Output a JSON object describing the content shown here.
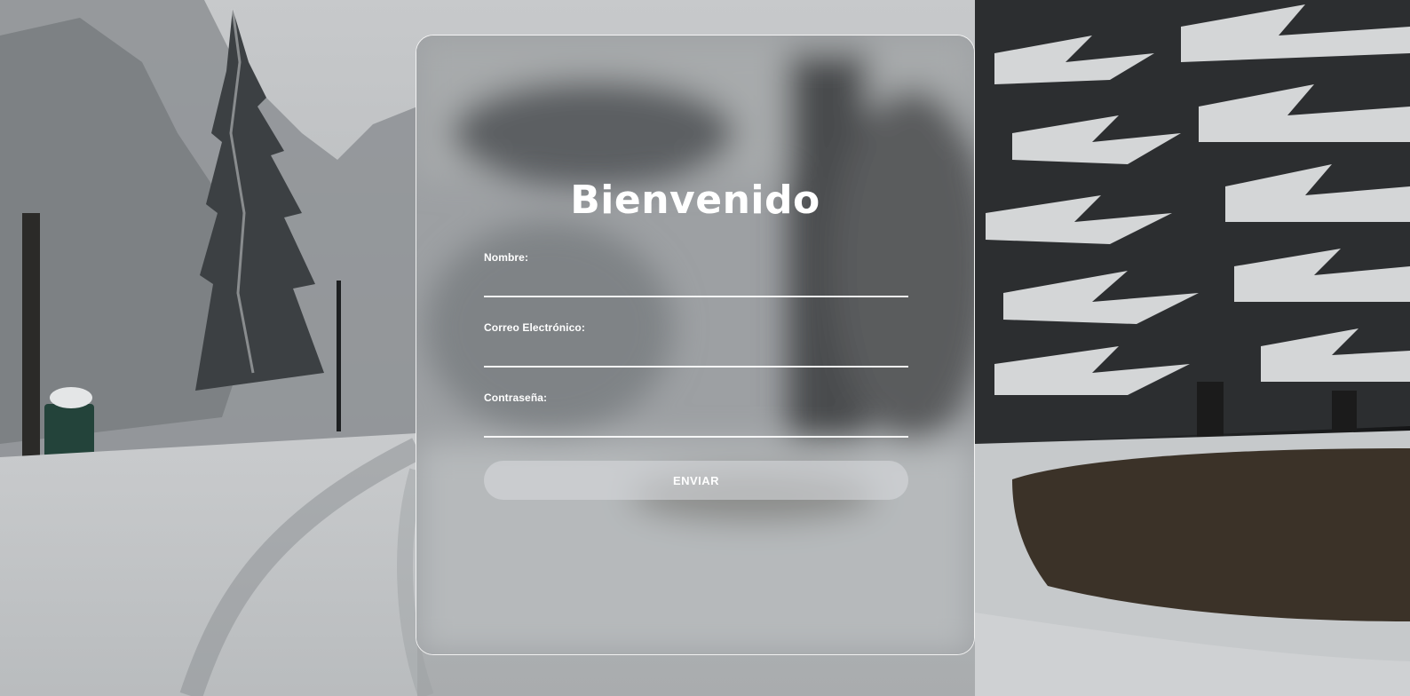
{
  "form": {
    "title": "Bienvenido",
    "fields": [
      {
        "label": "Nombre:",
        "value": ""
      },
      {
        "label": "Correo Electrónico:",
        "value": ""
      },
      {
        "label": "Contraseña:",
        "value": ""
      }
    ],
    "submit_label": "ENVIAR"
  }
}
